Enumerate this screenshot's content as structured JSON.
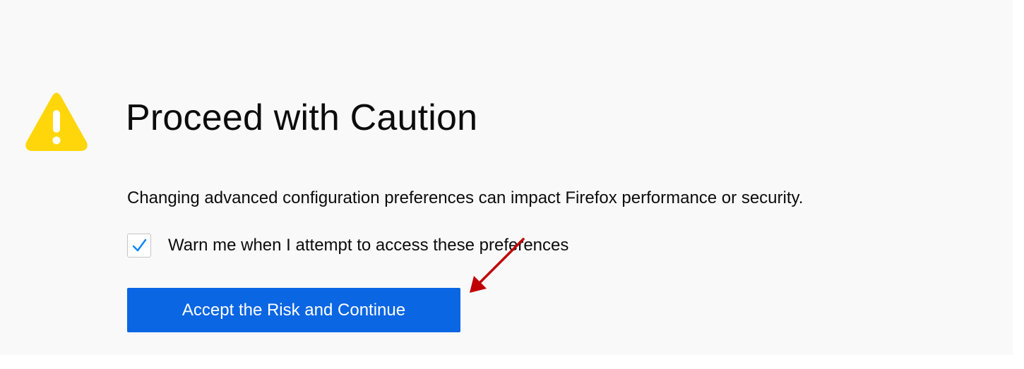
{
  "page": {
    "title": "Proceed with Caution",
    "description": "Changing advanced configuration preferences can impact Firefox performance or security.",
    "warning_icon": "warning-triangle-icon",
    "warn_checkbox": {
      "label": "Warn me when I attempt to access these preferences",
      "checked": true
    },
    "accept_button_label": "Accept the Risk and Continue"
  },
  "colors": {
    "background": "#f9f9fa",
    "warning_yellow": "#ffd60a",
    "button_blue": "#0a66e3",
    "checkmark_blue": "#0a84ff",
    "annotation_arrow": "#c00000"
  }
}
